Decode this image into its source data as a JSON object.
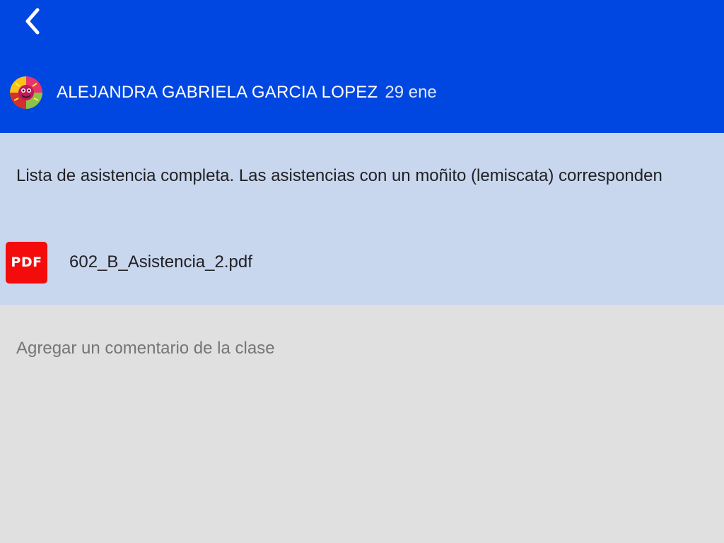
{
  "header": {
    "back_icon": "chevron-left-icon",
    "background_color": "#0047e1",
    "author_name": "ALEJANDRA GABRIELA GARCIA LOPEZ",
    "date": "29 ene",
    "avatar_icon": "user-avatar"
  },
  "post": {
    "background_color": "#c8d6ee",
    "text": "Lista de asistencia completa. Las asistencias con un moñito (lemiscata) corresponden",
    "attachment": {
      "icon": "pdf-icon",
      "icon_label": "PDF",
      "icon_color": "#f40c0c",
      "file_name": "602_B_Asistencia_2.pdf"
    }
  },
  "comment": {
    "placeholder": "Agregar un comentario de la clase",
    "value": ""
  }
}
